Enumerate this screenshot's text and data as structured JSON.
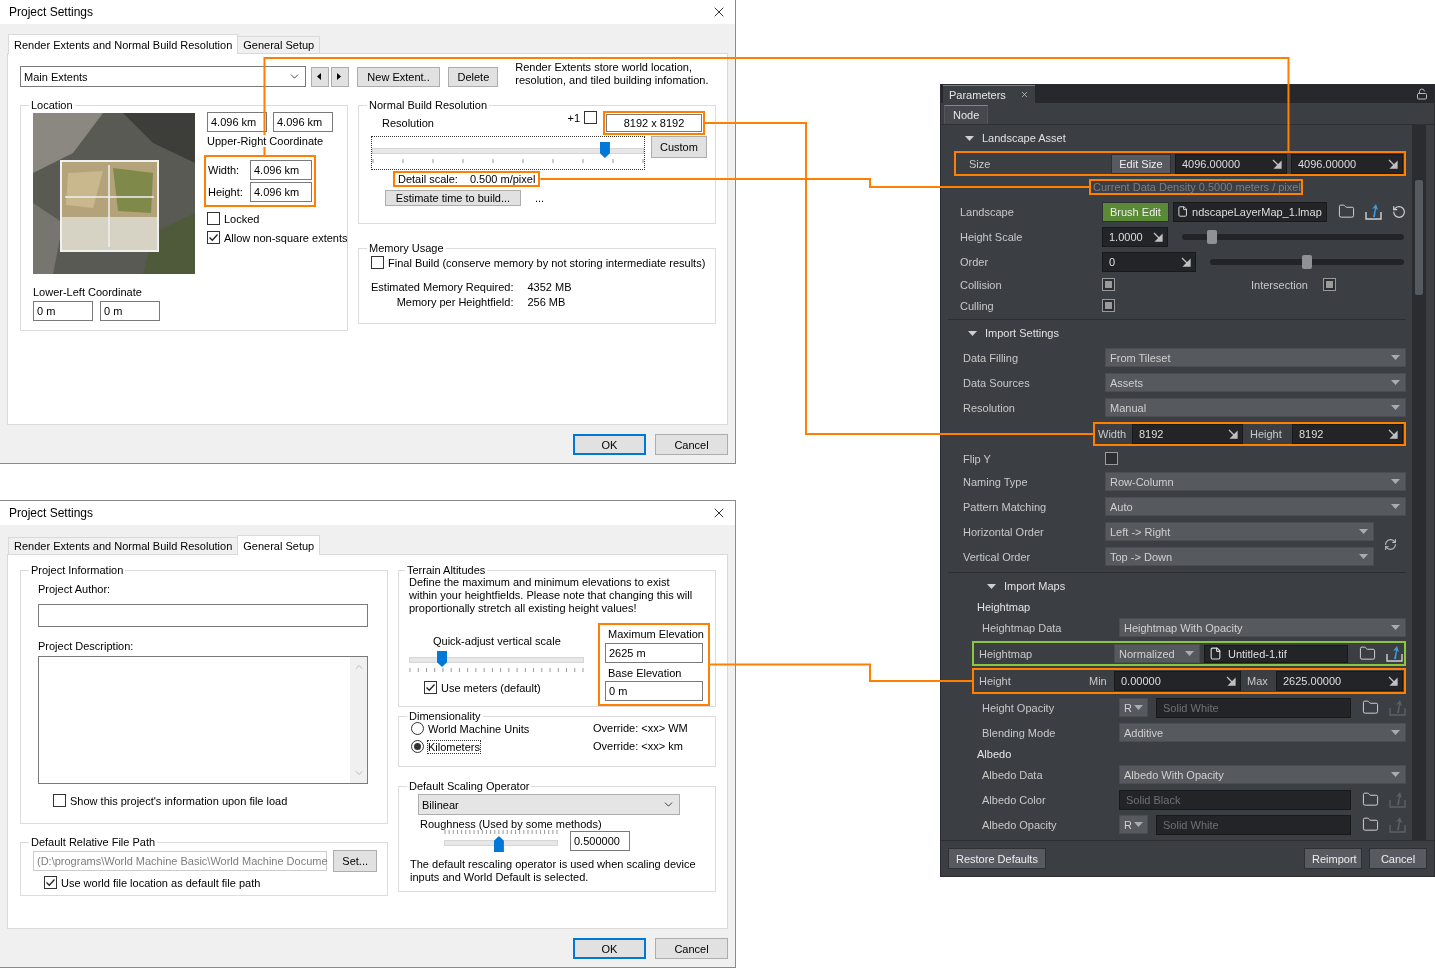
{
  "extents_dialog": {
    "title": "Project Settings",
    "tabs": [
      {
        "label": "Render Extents and Normal Build Resolution",
        "selected": true
      },
      {
        "label": "General Setup",
        "selected": false
      }
    ],
    "extent_select": "Main Extents",
    "new_button": "New Extent..",
    "delete_button": "Delete",
    "info": "Render Extents store world location, resolution, and tiled building infomation.",
    "location": {
      "legend": "Location",
      "upper_right": [
        "4.096 km",
        "4.096 km"
      ],
      "upper_right_label": "Upper-Right Coordinate",
      "width_label": "Width:",
      "width": "4.096 km",
      "height_label": "Height:",
      "height": "4.096 km",
      "locked": {
        "label": "Locked",
        "checked": false
      },
      "non_square": {
        "label": "Allow non-square extents",
        "checked": true
      },
      "lower_left_label": "Lower-Left Coordinate",
      "lower_left": [
        "0 m",
        "0 m"
      ]
    },
    "resolution": {
      "legend": "Normal Build Resolution",
      "label": "Resolution",
      "plus_one": {
        "label": "+1",
        "checked": false
      },
      "value": "8192 x 8192",
      "level": 0.87,
      "custom_button": "Custom",
      "detail_label": "Detail scale:",
      "detail_value": "0.500 m/pixel",
      "estimate_button": "Estimate time to build...",
      "estimate_result": "..."
    },
    "memory": {
      "legend": "Memory Usage",
      "final_build": {
        "label": "Final Build (conserve memory by not storing intermediate results)",
        "checked": false
      },
      "rows": [
        {
          "label": "Estimated Memory Required:",
          "value": "4352 MB"
        },
        {
          "label": "Memory per Heightfield:",
          "value": "256 MB"
        }
      ]
    },
    "ok_button": "OK",
    "cancel_button": "Cancel"
  },
  "general_dialog": {
    "title": "Project Settings",
    "tabs": [
      {
        "label": "Render Extents and Normal Build Resolution",
        "selected": false
      },
      {
        "label": "General Setup",
        "selected": true
      }
    ],
    "project_info": {
      "legend": "Project Information",
      "author_label": "Project Author:",
      "description_label": "Project Description:",
      "show_info": {
        "label": "Show this project's information upon file load",
        "checked": false
      }
    },
    "file_path": {
      "legend": "Default Relative File Path",
      "path": "(D:\\programs\\World Machine Basic\\World Machine Docume",
      "set_button": "Set...",
      "use_world": {
        "label": "Use world file location as default file path",
        "checked": true
      }
    },
    "terrain": {
      "legend": "Terrain Altitudes",
      "description": "Define the maximum and minimum elevations to exist within your heightfields. Please note that changing this will proportionally stretch all existing height values!",
      "quick_label": "Quick-adjust vertical scale",
      "level": 0.17,
      "use_meters": {
        "label": "Use meters (default)",
        "checked": true
      },
      "max_label": "Maximum Elevation",
      "max": "2625 m",
      "base_label": "Base Elevation",
      "base": "0 m"
    },
    "dimensionality": {
      "legend": "Dimensionality",
      "options": [
        {
          "label": "World Machine Units",
          "override": "Override: <xx> WM",
          "selected": false
        },
        {
          "label": "Kilometers",
          "override": "Override: <xx> km",
          "selected": true
        }
      ]
    },
    "scaling": {
      "legend": "Default Scaling Operator",
      "select": "Bilinear",
      "roughness_label": "Roughness (Used by some methods)",
      "level": 0.48,
      "roughness_value": "0.500000",
      "note": "The default rescaling operator is used when scaling device inputs and World Default is selected."
    },
    "ok_button": "OK",
    "cancel_button": "Cancel"
  },
  "parameters_panel": {
    "tab": "Parameters",
    "subtab": "Node",
    "sections": [
      {
        "title": "Landscape Asset",
        "expanded": true,
        "rows": [
          {
            "kind": "size",
            "label": "Size",
            "button": "Edit Size",
            "values": [
              "4096.00000",
              "4096.00000"
            ]
          },
          {
            "kind": "note",
            "text": "Current Data Density 0.5000 meters / pixel"
          },
          {
            "kind": "file",
            "label": "Landscape",
            "button": "Brush Edit",
            "file": "ndscapeLayerMap_1.lmap"
          },
          {
            "kind": "slider",
            "label": "Height Scale",
            "value": "1.0000",
            "level": 0.12
          },
          {
            "kind": "slider",
            "label": "Order",
            "value": "0",
            "level": 0.5
          },
          {
            "kind": "checks",
            "label": "Collision",
            "checked": true,
            "second_label": "Intersection",
            "second_checked": true
          },
          {
            "kind": "check",
            "label": "Culling",
            "checked": true
          }
        ]
      },
      {
        "title": "Import Settings",
        "expanded": true,
        "rows": [
          {
            "kind": "select",
            "label": "Data Filling",
            "value": "From Tileset"
          },
          {
            "kind": "select",
            "label": "Data Sources",
            "value": "Assets"
          },
          {
            "kind": "select",
            "label": "Resolution",
            "value": "Manual"
          },
          {
            "kind": "size_pair",
            "first_label": "Width",
            "first": "8192",
            "second_label": "Height",
            "second": "8192"
          },
          {
            "kind": "check",
            "label": "Flip Y",
            "checked": false
          },
          {
            "kind": "select",
            "label": "Naming Type",
            "value": "Row-Column"
          },
          {
            "kind": "select",
            "label": "Pattern Matching",
            "value": "Auto"
          },
          {
            "kind": "order",
            "items": [
              {
                "label": "Horizontal Order",
                "value": "Left -> Right"
              },
              {
                "label": "Vertical Order",
                "value": "Top -> Down"
              }
            ]
          }
        ]
      },
      {
        "title": "Import Maps",
        "expanded": true,
        "rows": [
          {
            "kind": "heading",
            "text": "Heightmap"
          },
          {
            "kind": "select",
            "label": "Heightmap Data",
            "value": "Heightmap With Opacity"
          },
          {
            "kind": "map",
            "label": "Heightmap",
            "mode": "Normalized",
            "file": "Untitled-1.tif"
          },
          {
            "kind": "minmax",
            "label": "Height",
            "min_label": "Min",
            "min": "0.00000",
            "max_label": "Max",
            "max": "2625.00000"
          },
          {
            "kind": "channel",
            "label": "Height Opacity",
            "channel": "R",
            "placeholder": "Solid White"
          },
          {
            "kind": "select",
            "label": "Blending Mode",
            "value": "Additive"
          },
          {
            "kind": "heading",
            "text": "Albedo"
          },
          {
            "kind": "select",
            "label": "Albedo Data",
            "value": "Albedo With Opacity"
          },
          {
            "kind": "source",
            "label": "Albedo Color",
            "placeholder": "Solid Black"
          },
          {
            "kind": "channel",
            "label": "Albedo Opacity",
            "channel": "R",
            "placeholder": "Solid White"
          }
        ]
      }
    ],
    "restore_button": "Restore Defaults",
    "reimport_button": "Reimport",
    "cancel_button": "Cancel"
  },
  "callouts": [
    {
      "color": "#ff8000"
    },
    {
      "color": "#ff8000"
    },
    {
      "color": "#ff8000"
    },
    {
      "color": "#ff8000"
    },
    {
      "color": "#8cc63f"
    }
  ]
}
